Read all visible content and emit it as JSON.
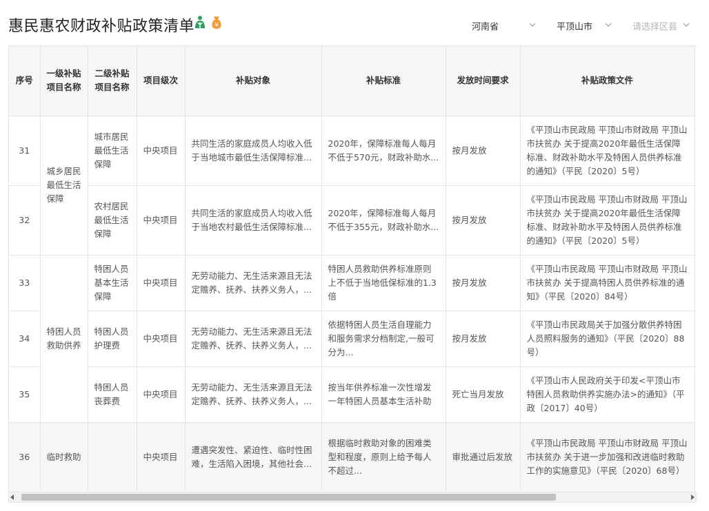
{
  "page": {
    "title": "惠民惠农财政补贴政策清单",
    "icons": [
      "person-plant-icon",
      "money-bag-icon"
    ]
  },
  "filters": {
    "province": "河南省",
    "city": "平顶山市",
    "county_placeholder": "请选择区县"
  },
  "table": {
    "headers": {
      "seq": "序号",
      "level1": "一级补贴项目名称",
      "level2": "二级补贴项目名称",
      "tier": "项目级次",
      "target": "补贴对象",
      "standard": "补贴标准",
      "timing": "发放时间要求",
      "doc": "补贴政策文件"
    },
    "groups": {
      "g1": "城乡居民最低生活保障",
      "g2": "特困人员救助供养",
      "g3": "临时救助"
    },
    "rows": [
      {
        "seq": "31",
        "level2": "城市居民最低生活保障",
        "tier": "中央项目",
        "target": "共同生活的家庭成员人均收入低于当地城市最低生活保障标准...",
        "standard": "2020年，保障标准每人每月不低于570元，财政补助水...",
        "timing": "按月发放",
        "doc": "《平顶山市民政局 平顶山市财政局 平顶山市扶贫办 关于提高2020年最低生活保障标准、财政补助水平及特困人员供养标准的通知》（平民〔2020〕5号）"
      },
      {
        "seq": "32",
        "level2": "农村居民最低生活保障",
        "tier": "中央项目",
        "target": "共同生活的家庭成员人均收入低于当地农村最低生活保障标准...",
        "standard": "2020年，保障标准每人每月不低于355元，财政补助水...",
        "timing": "按月发放",
        "doc": "《平顶山市民政局 平顶山市财政局 平顶山市扶贫办 关于提高2020年最低生活保障标准、财政补助水平及特困人员供养标准的通知》（平民〔2020〕5号）"
      },
      {
        "seq": "33",
        "level2": "特困人员基本生活保障",
        "tier": "中央项目",
        "target": "无劳动能力、无生活来源且无法定赡养、抚养、扶养义务人，...",
        "standard": "特困人员救助供养标准原则上不低于当地低保标准的1.3倍",
        "timing": "按月发放",
        "doc": "《平顶山市民政局 平顶山市财政局 平顶山市扶贫办 关于提高特困人员供养标准的通知》（平民〔2020〕84号）"
      },
      {
        "seq": "34",
        "level2": "特困人员护理费",
        "tier": "中央项目",
        "target": "无劳动能力、无生活来源且无法定赡养、抚养、扶养义务人，...",
        "standard": "依据特困人员生活自理能力和服务需求分档制定,一般可分为...",
        "timing": "按月发放",
        "doc": "《平顶山市民政局关于加强分散供养特困人员照料服务的通知》（平民〔2020〕88号）"
      },
      {
        "seq": "35",
        "level2": "特困人员丧葬费",
        "tier": "中央项目",
        "target": "无劳动能力、无生活来源且无法定赡养、抚养、扶养义务人，...",
        "standard": "按当年供养标准一次性增发一年特困人员基本生活补助",
        "timing": "死亡当月发放",
        "doc": "《平顶山市人民政府关于印发<平顶山市特困人员救助供养实施办法>的通知》（平政〔2017〕40号）"
      },
      {
        "seq": "36",
        "level2": "",
        "tier": "中央项目",
        "target": "遭遇突发性、紧迫性、临时性困难，生活陷入困境，其他社会...",
        "standard": "根据临时救助对象的困难类型和程度，原则上给予每人不超过...",
        "timing": "审批通过后发放",
        "doc": "《平顶山市民政局 平顶山市财政局 平顶山市扶贫办 关于进一步加强和改进临时救助工作的实施意见》（平民〔2020〕68号）"
      }
    ]
  },
  "colors": {
    "header_bg": "#f5f6f7",
    "border": "#e4e4e4",
    "watermark": "#dc3c3c"
  }
}
